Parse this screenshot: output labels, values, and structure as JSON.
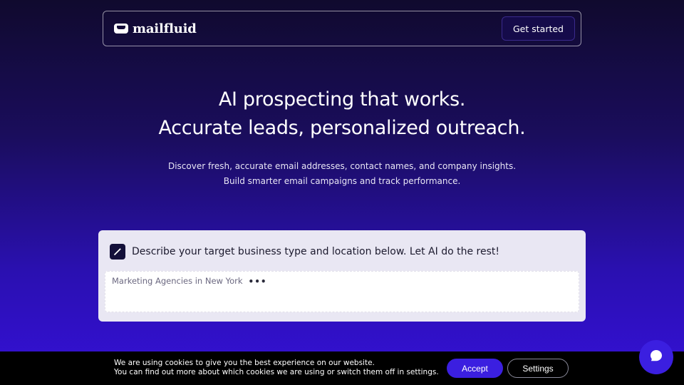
{
  "header": {
    "logo_text": "mailfluid",
    "cta_label": "Get started"
  },
  "hero": {
    "title_line1": "AI prospecting that works.",
    "title_line2": "Accurate leads, personalized outreach.",
    "subtitle_line1": "Discover fresh, accurate email addresses, contact names, and company insights.",
    "subtitle_line2": "Build smarter email campaigns and track performance."
  },
  "prompt": {
    "label": "Describe your target business type and location below. Let AI do the rest!",
    "input_text": "Marketing Agencies in New York",
    "typing_indicator": "•••"
  },
  "cookie": {
    "line1": "We are using cookies to give you the best experience on our website.",
    "line2": "You can find out more about which cookies we are using or switch them off in settings.",
    "accept_label": "Accept",
    "settings_label": "Settings"
  },
  "icons": {
    "logo": "mail-tray-icon",
    "prompt": "magic-wand-icon",
    "chat": "chat-bubble-icon"
  },
  "colors": {
    "accent": "#3b1fe0",
    "card_bg": "#e9e7f3"
  }
}
